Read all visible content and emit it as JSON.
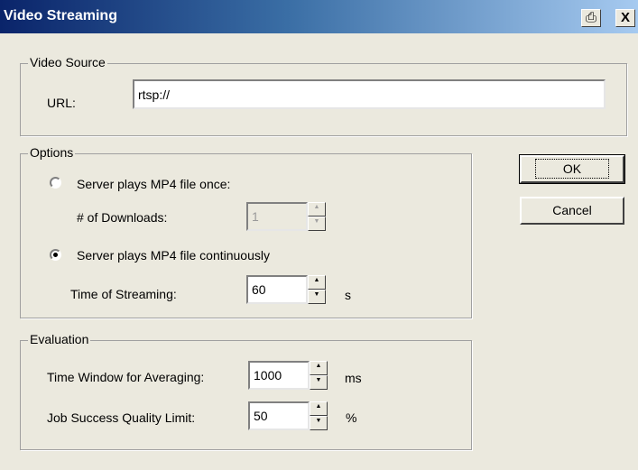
{
  "window": {
    "title": "Video Streaming",
    "print_icon": "printer-icon",
    "close_label": "X"
  },
  "video_source": {
    "legend": "Video Source",
    "url_label": "URL:",
    "url_value": "rtsp://"
  },
  "options": {
    "legend": "Options",
    "once_label": "Server plays MP4 file once:",
    "once_selected": false,
    "downloads_label": "# of Downloads:",
    "downloads_value": "1",
    "continuous_label": "Server plays MP4 file continuously",
    "continuous_selected": true,
    "time_label": "Time of Streaming:",
    "time_value": "60",
    "time_unit": "s"
  },
  "evaluation": {
    "legend": "Evaluation",
    "window_label": "Time Window for Averaging:",
    "window_value": "1000",
    "window_unit": "ms",
    "quality_label": "Job Success Quality Limit:",
    "quality_value": "50",
    "quality_unit": "%"
  },
  "buttons": {
    "ok": "OK",
    "cancel": "Cancel"
  }
}
